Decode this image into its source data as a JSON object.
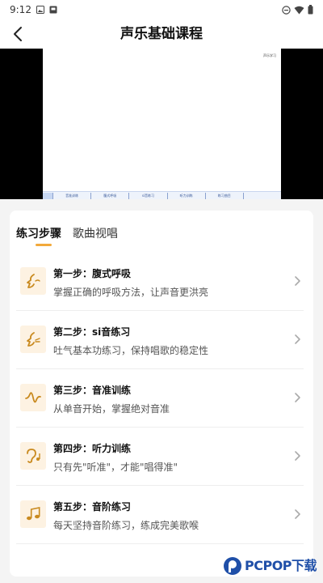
{
  "status_bar": {
    "time": "9:12",
    "icons_left": [
      "gallery-icon",
      "download-box-icon"
    ],
    "icons_right": [
      "do-not-disturb-icon",
      "wifi-icon",
      "battery-icon"
    ]
  },
  "header": {
    "title": "声乐基础课程",
    "back_icon": "chevron-left-icon"
  },
  "video": {
    "tag_line1": "声乐学习",
    "tag_line2": "",
    "bottom_segments": [
      "",
      "音准训练",
      "腹式呼吸",
      "si音练习",
      "听力训练",
      "练习曲目",
      ""
    ]
  },
  "tabs": [
    {
      "label": "练习步骤",
      "active": true
    },
    {
      "label": "歌曲视唱",
      "active": false
    }
  ],
  "steps": [
    {
      "title": "第一步：腹式呼吸",
      "desc": "掌握正确的呼吸方法，让声音更洪亮",
      "icon": "breathing-icon"
    },
    {
      "title": "第二步：si音练习",
      "desc": "吐气基本功练习，保持唱歌的稳定性",
      "icon": "exhale-icon"
    },
    {
      "title": "第三步：音准训练",
      "desc": "从单音开始，掌握绝对音准",
      "icon": "waveform-icon"
    },
    {
      "title": "第四步：听力训练",
      "desc": "只有先\"听准\"，才能\"唱得准\"",
      "icon": "ear-note-icon"
    },
    {
      "title": "第五步：音阶练习",
      "desc": "每天坚持音阶练习，练成完美歌喉",
      "icon": "music-notes-icon"
    }
  ],
  "watermark": {
    "brand": "PCPOP下载",
    "sub": "",
    "logo_icon": "pcpop-logo-icon"
  },
  "colors": {
    "accent": "#f2a93b",
    "icon_bg": "#fdf2e2",
    "brand_blue": "#1f4fa8"
  }
}
